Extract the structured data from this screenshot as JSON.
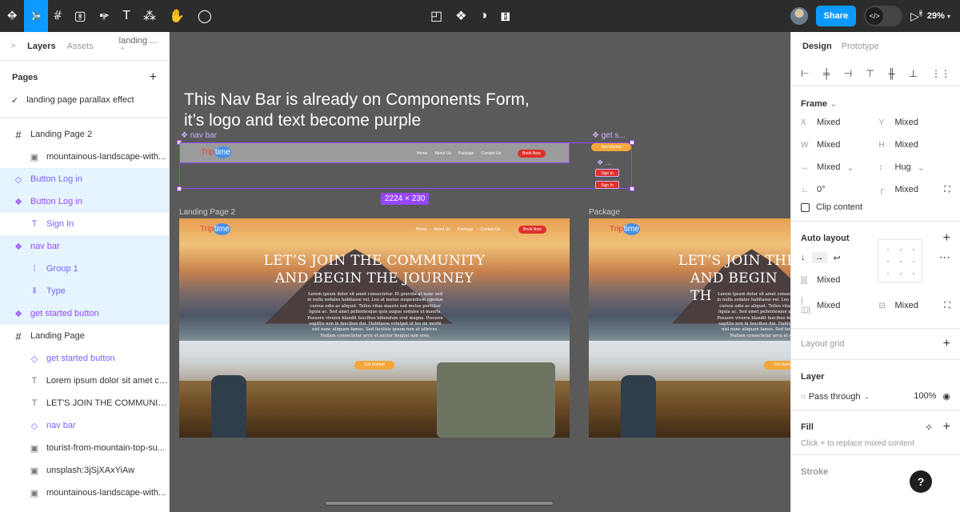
{
  "toolbar": {
    "share": "Share",
    "zoom": "29%"
  },
  "left_panel": {
    "tabs": [
      "Layers",
      "Assets"
    ],
    "page_dropdown": "landing ...",
    "pages_title": "Pages",
    "current_page": "landing page parallax effect",
    "layers": [
      {
        "label": "Landing Page 2",
        "kind": "frame"
      },
      {
        "label": "mountainous-landscape-with...",
        "kind": "image"
      },
      {
        "label": "Button Log in",
        "kind": "component"
      },
      {
        "label": "Button Log in",
        "kind": "component-set"
      },
      {
        "label": "Sign In",
        "kind": "text"
      },
      {
        "label": "nav bar",
        "kind": "component-set"
      },
      {
        "label": "Group 1",
        "kind": "group"
      },
      {
        "label": "Type",
        "kind": "type"
      },
      {
        "label": "get started button",
        "kind": "component-set"
      },
      {
        "label": "Landing Page",
        "kind": "frame"
      },
      {
        "label": "get started button",
        "kind": "instance"
      },
      {
        "label": "Lorem ipsum dolor sit amet co...",
        "kind": "text"
      },
      {
        "label": "LET'S JOIN THE COMMUNIT...",
        "kind": "text"
      },
      {
        "label": "nav bar",
        "kind": "instance"
      },
      {
        "label": "tourist-from-mountain-top-su...",
        "kind": "image"
      },
      {
        "label": "unsplash:3jSjXAxYiAw",
        "kind": "image"
      },
      {
        "label": "mountainous-landscape-with...",
        "kind": "image"
      }
    ]
  },
  "canvas": {
    "note": "This Nav Bar is already on Components Form, it’s logo and text become purple",
    "nav_label": "nav bar",
    "get_label": "get s...",
    "small_label": "...",
    "dimensions": "2224 × 230",
    "frame1_label": "Landing Page 2",
    "frame2_label": "Package",
    "logo_a": "Trip",
    "logo_b": "time",
    "nav_links": [
      "Home",
      "About Us",
      "Package",
      "Contact Us"
    ],
    "book_now": "Book Now",
    "get_started": "Get Started",
    "sign_in": "Sign In",
    "hero_title_1": "LET’S JOIN THE COMMUNITY",
    "hero_title_2": "AND BEGIN THE JOURNEY",
    "hero_body": "Lorem ipsum dolor sit amet consectetur. Et gravida at nunc sed in nulla sodales habitasse vel. Leo at metus suspendisse egestas cursus odio ac aliquet. Tellus vitae mauris sed metus porttitor ligula ac. Sed amet pellentesque quis augue sodales ut mauris. Posuere viverra blandit faucibus bibendum erat magna. Posuere sagittis non in faucibus dui. Habitasse volutpat id leo mi morbi nisl nunc aliquam fames. Sed facilisis ipsum non ut ultrices. Nullam consectetur arcu et auctor feugiat non eros.",
    "frame2_title_1": "LET’S JOIN THE",
    "frame2_title_2": "AND BEGIN TH"
  },
  "right_panel": {
    "tabs": [
      "Design",
      "Prototype"
    ],
    "frame_title": "Frame",
    "x": "Mixed",
    "y": "Mixed",
    "w": "Mixed",
    "h": "Mixed",
    "width_mode": "Mixed",
    "height_mode": "Hug",
    "rotation": "0°",
    "radius": "Mixed",
    "clip_content": "Clip content",
    "auto_layout": "Auto layout",
    "spacing": "Mixed",
    "padding_h": "Mixed",
    "padding_v": "Mixed",
    "layout_grid": "Layout grid",
    "layer_title": "Layer",
    "blend": "Pass through",
    "opacity": "100%",
    "fill_title": "Fill",
    "fill_hint": "Click + to replace mixed content",
    "stroke_title": "Stroke"
  }
}
